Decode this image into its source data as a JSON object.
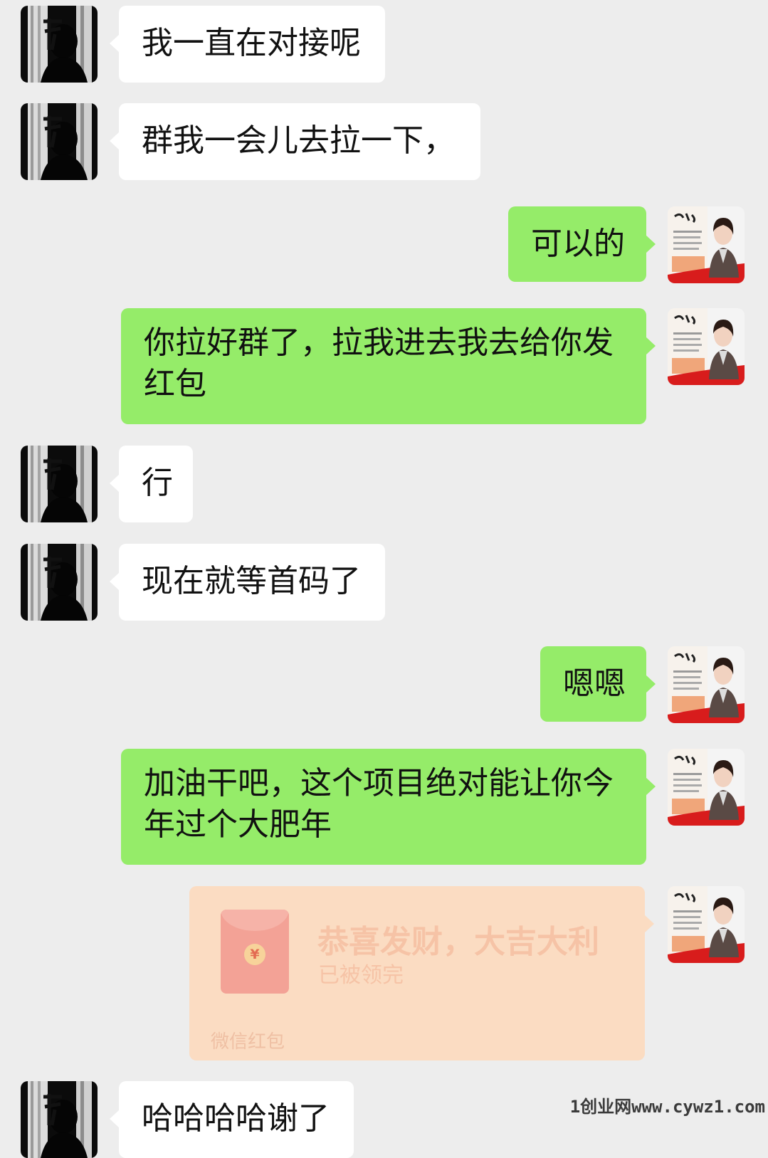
{
  "messages": {
    "m1": "我一直在对接呢",
    "m2": "群我一会儿去拉一下，",
    "m3": "可以的",
    "m4": "你拉好群了，拉我进去我去给你发红包",
    "m5": "行",
    "m6": "现在就等首码了",
    "m7": "嗯嗯",
    "m8": "加油干吧，这个项目绝对能让你今年过个大肥年",
    "m10": "哈哈哈哈谢了"
  },
  "red_packet": {
    "title": "恭喜发财，大吉大利",
    "status": "已被领完",
    "footer": "微信红包",
    "coin_symbol": "¥"
  },
  "watermark": "1创业网www.cywz1.com",
  "colors": {
    "background": "#ededed",
    "incoming_bubble": "#ffffff",
    "outgoing_bubble": "#95ec69",
    "red_packet_bg": "#fbdcc2"
  }
}
